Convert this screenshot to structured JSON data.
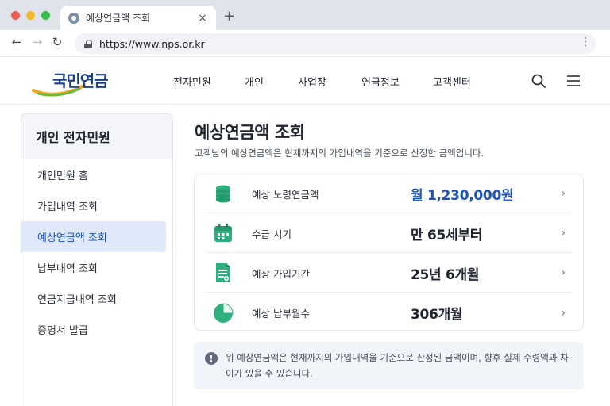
{
  "browser": {
    "tab_title": "예상연금액 조회",
    "tab_close": "×",
    "new_tab": "+",
    "url": "https://www.nps.or.kr",
    "back": "←",
    "forward": "→",
    "reload": "↻",
    "menu": "⋮"
  },
  "site": {
    "logo_text": "국민연금",
    "nav": [
      "전자민원",
      "개인",
      "사업장",
      "연금정보",
      "고객센터"
    ],
    "search_icon": "search-icon",
    "menu_icon": "hamburger-icon"
  },
  "sidebar": {
    "title": "개인 전자민원",
    "items": [
      {
        "label": "개인민원 홈"
      },
      {
        "label": "가입내역 조회"
      },
      {
        "label": "예상연금액 조회",
        "active": true
      },
      {
        "label": "납부내역 조회"
      },
      {
        "label": "연금지급내역 조회"
      },
      {
        "label": "증명서 발급"
      }
    ]
  },
  "main": {
    "title": "예상연금액 조회",
    "description": "고객님의 예상연금액은 현재까지의 가입내역을 기준으로 산정한 금액입니다.",
    "rows": [
      {
        "icon": "coins-icon",
        "label": "예상 노령연금액",
        "value": "월 1,230,000원"
      },
      {
        "icon": "calendar-icon",
        "label": "수급 시기",
        "value": "만 65세부터"
      },
      {
        "icon": "document-icon",
        "label": "예상 가입기간",
        "value": "25년 6개월"
      },
      {
        "icon": "pie-chart-icon",
        "label": "예상 납부월수",
        "value": "306개월"
      }
    ],
    "chevron": "›",
    "notice_icon": "!",
    "notice": "위 예상연금액은 현재까지의 가입내역을 기준으로 산정된 금액이며, 향후 실제 수령액과 차이가 있을 수 있습니다."
  },
  "colors": {
    "brand_blue": "#1b3f8f",
    "accent_blue": "#1c54b8",
    "active_bg": "#dfe9fa",
    "icon_green": "#2fae7e"
  }
}
